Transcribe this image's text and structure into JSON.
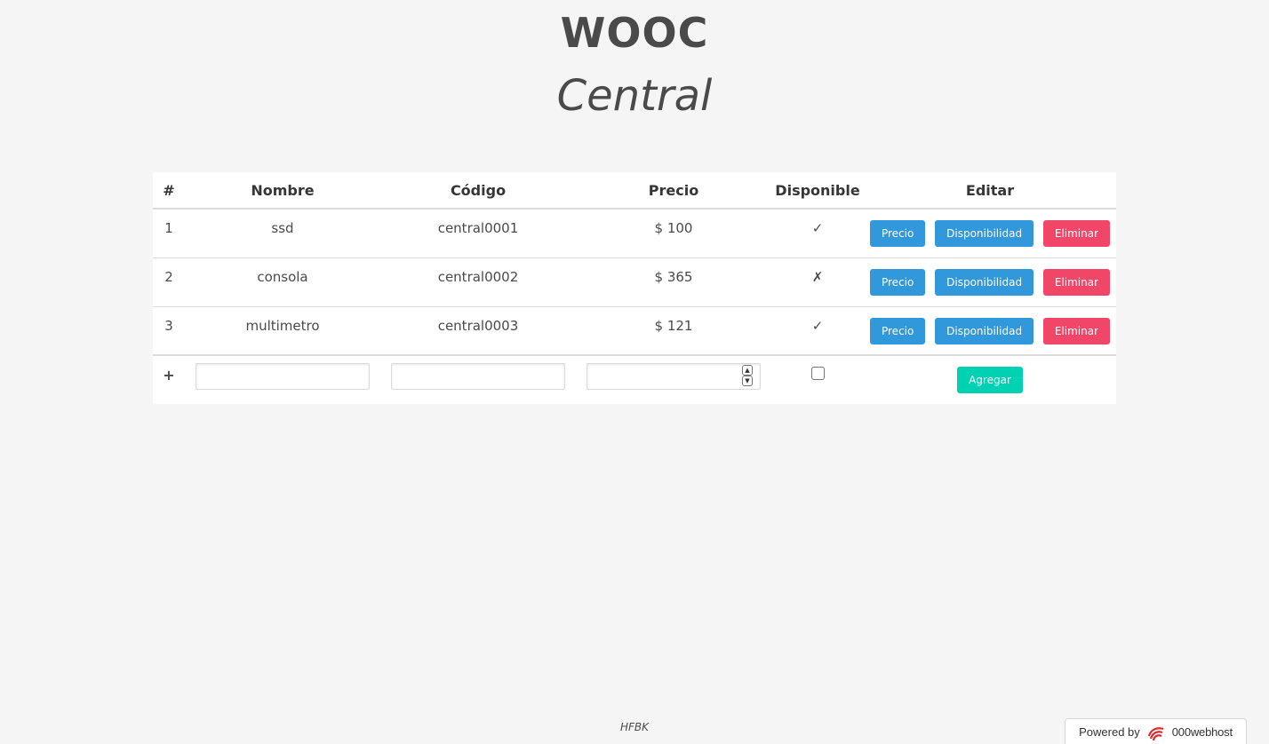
{
  "header": {
    "brand": "WOOC",
    "subtitle": "Central"
  },
  "table": {
    "columns": [
      "#",
      "Nombre",
      "Código",
      "Precio",
      "Disponible",
      "Editar"
    ],
    "rows": [
      {
        "num": "1",
        "name": "ssd",
        "code": "central0001",
        "price": "$ 100",
        "available": "✓"
      },
      {
        "num": "2",
        "name": "consola",
        "code": "central0002",
        "price": "$ 365",
        "available": "✗"
      },
      {
        "num": "3",
        "name": "multimetro",
        "code": "central0003",
        "price": "$ 121",
        "available": "✓"
      }
    ],
    "actions": {
      "price": "Precio",
      "availability": "Disponibilidad",
      "delete": "Eliminar"
    },
    "add_row": {
      "plus": "+",
      "add_button": "Agregar"
    }
  },
  "footer": {
    "text": "HFBK"
  },
  "badge": {
    "prefix": "Powered by",
    "brand": "000webhost"
  },
  "colors": {
    "info": "#3298dc",
    "danger": "#f14668",
    "primary": "#00d1b2",
    "background": "#f5f5f5"
  }
}
